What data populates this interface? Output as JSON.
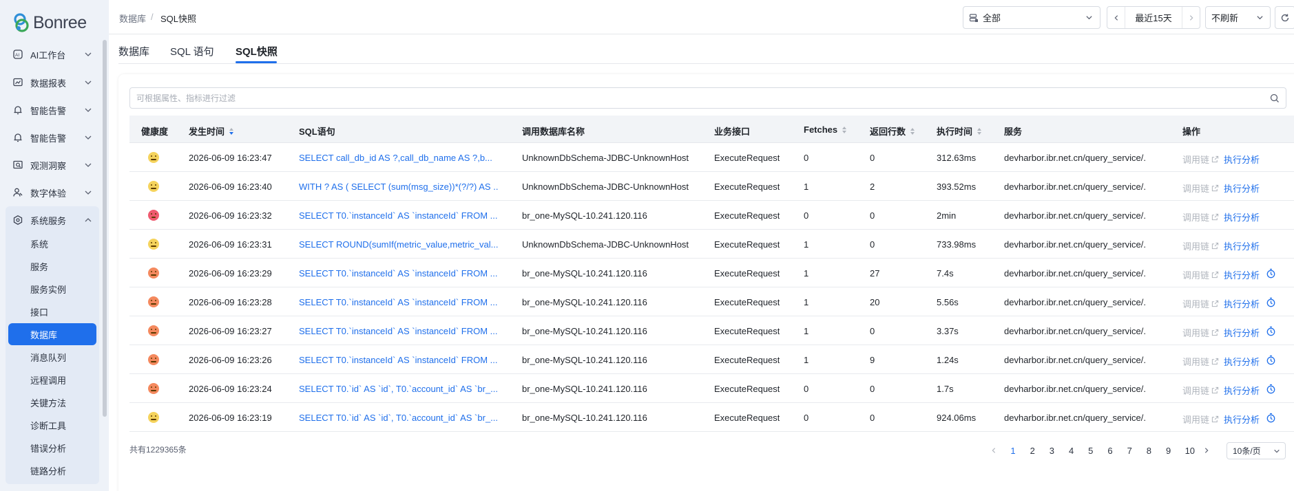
{
  "brand": {
    "name": "Bonree"
  },
  "sidebar": {
    "items": [
      {
        "label": "AI工作台",
        "icon": "ai-icon"
      },
      {
        "label": "数据报表",
        "icon": "chart-icon"
      },
      {
        "label": "智能告警",
        "icon": "alarm-icon"
      },
      {
        "label": "智能告警",
        "icon": "alarm-icon"
      },
      {
        "label": "观测洞察",
        "icon": "monitor-icon"
      },
      {
        "label": "数字体验",
        "icon": "user-experience-icon"
      },
      {
        "label": "系统服务",
        "icon": "system-service-icon"
      }
    ],
    "sub_items": [
      "系统",
      "服务",
      "服务实例",
      "接口",
      "数据库",
      "消息队列",
      "远程调用",
      "关键方法",
      "诊断工具",
      "错误分析",
      "链路分析"
    ],
    "active_sub": "数据库"
  },
  "breadcrumb": {
    "parent": "数据库",
    "separator": "/",
    "current": "SQL快照"
  },
  "toolbar": {
    "scope": "全部",
    "time_range": "最近15天",
    "refresh": "不刷新"
  },
  "tabs": [
    "数据库",
    "SQL 语句",
    "SQL快照"
  ],
  "active_tab": "SQL快照",
  "filter": {
    "placeholder": "可根据属性、指标进行过滤"
  },
  "table": {
    "columns": [
      "健康度",
      "发生时间",
      "SQL语句",
      "调用数据库名称",
      "业务接口",
      "Fetches",
      "返回行数",
      "执行时间",
      "服务",
      "操作"
    ],
    "rows": [
      {
        "health": "neutral",
        "time": "2026-06-09 16:23:47",
        "sql": "SELECT call_db_id AS ?,call_db_name AS ?,b...",
        "db": "UnknownDbSchema-JDBC-UnknownHost",
        "api": "ExecuteRequest",
        "fetches": "0",
        "rows": "0",
        "exec": "312.63ms",
        "service": "devharbor.ibr.net.cn/query_service/...",
        "trace": "调用链",
        "analyze": "执行分析",
        "timer": false
      },
      {
        "health": "neutral",
        "time": "2026-06-09 16:23:40",
        "sql": "WITH ? AS ( SELECT (sum(msg_size))*(?/?) AS ...",
        "db": "UnknownDbSchema-JDBC-UnknownHost",
        "api": "ExecuteRequest",
        "fetches": "1",
        "rows": "2",
        "exec": "393.52ms",
        "service": "devharbor.ibr.net.cn/query_service/...",
        "trace": "调用链",
        "analyze": "执行分析",
        "timer": false
      },
      {
        "health": "bad",
        "time": "2026-06-09 16:23:32",
        "sql": "SELECT T0.`instanceId` AS `instanceId` FROM ...",
        "db": "br_one-MySQL-10.241.120.116",
        "api": "ExecuteRequest",
        "fetches": "0",
        "rows": "0",
        "exec": "2min",
        "service": "devharbor.ibr.net.cn/query_service/...",
        "trace": "调用链",
        "analyze": "执行分析",
        "timer": false
      },
      {
        "health": "neutral",
        "time": "2026-06-09 16:23:31",
        "sql": "SELECT ROUND(sumIf(metric_value,metric_val...",
        "db": "UnknownDbSchema-JDBC-UnknownHost",
        "api": "ExecuteRequest",
        "fetches": "1",
        "rows": "0",
        "exec": "733.98ms",
        "service": "devharbor.ibr.net.cn/query_service/...",
        "trace": "调用链",
        "analyze": "执行分析",
        "timer": false
      },
      {
        "health": "warn",
        "time": "2026-06-09 16:23:29",
        "sql": "SELECT T0.`instanceId` AS `instanceId` FROM ...",
        "db": "br_one-MySQL-10.241.120.116",
        "api": "ExecuteRequest",
        "fetches": "1",
        "rows": "27",
        "exec": "7.4s",
        "service": "devharbor.ibr.net.cn/query_service/...",
        "trace": "调用链",
        "analyze": "执行分析",
        "timer": true
      },
      {
        "health": "warn",
        "time": "2026-06-09 16:23:28",
        "sql": "SELECT T0.`instanceId` AS `instanceId` FROM ...",
        "db": "br_one-MySQL-10.241.120.116",
        "api": "ExecuteRequest",
        "fetches": "1",
        "rows": "20",
        "exec": "5.56s",
        "service": "devharbor.ibr.net.cn/query_service/...",
        "trace": "调用链",
        "analyze": "执行分析",
        "timer": true
      },
      {
        "health": "warn",
        "time": "2026-06-09 16:23:27",
        "sql": "SELECT T0.`instanceId` AS `instanceId` FROM ...",
        "db": "br_one-MySQL-10.241.120.116",
        "api": "ExecuteRequest",
        "fetches": "1",
        "rows": "0",
        "exec": "3.37s",
        "service": "devharbor.ibr.net.cn/query_service/...",
        "trace": "调用链",
        "analyze": "执行分析",
        "timer": true
      },
      {
        "health": "warn",
        "time": "2026-06-09 16:23:26",
        "sql": "SELECT T0.`instanceId` AS `instanceId` FROM ...",
        "db": "br_one-MySQL-10.241.120.116",
        "api": "ExecuteRequest",
        "fetches": "1",
        "rows": "9",
        "exec": "1.24s",
        "service": "devharbor.ibr.net.cn/query_service/...",
        "trace": "调用链",
        "analyze": "执行分析",
        "timer": true
      },
      {
        "health": "warn",
        "time": "2026-06-09 16:23:24",
        "sql": "SELECT T0.`id` AS `id`, T0.`account_id` AS `br_...",
        "db": "br_one-MySQL-10.241.120.116",
        "api": "ExecuteRequest",
        "fetches": "0",
        "rows": "0",
        "exec": "1.7s",
        "service": "devharbor.ibr.net.cn/query_service/...",
        "trace": "调用链",
        "analyze": "执行分析",
        "timer": true
      },
      {
        "health": "neutral",
        "time": "2026-06-09 16:23:19",
        "sql": "SELECT T0.`id` AS `id`, T0.`account_id` AS `br_...",
        "db": "br_one-MySQL-10.241.120.116",
        "api": "ExecuteRequest",
        "fetches": "0",
        "rows": "0",
        "exec": "924.06ms",
        "service": "devharbor.ibr.net.cn/query_service/...",
        "trace": "调用链",
        "analyze": "执行分析",
        "timer": true
      }
    ]
  },
  "pagination": {
    "total": "共有1229365条",
    "pages": [
      "1",
      "2",
      "3",
      "4",
      "5",
      "6",
      "7",
      "8",
      "9",
      "10"
    ],
    "current": "1",
    "page_size": "10条/页"
  },
  "colors": {
    "accent": "#1f6feb",
    "neutral": "#f5d35c",
    "warn": "#f4895e",
    "bad": "#ef5a6f"
  }
}
